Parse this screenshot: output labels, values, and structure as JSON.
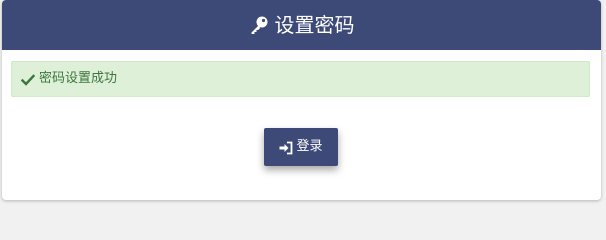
{
  "header": {
    "icon": "key-icon",
    "title": "设置密码",
    "background": "#3d4977"
  },
  "alert": {
    "icon": "check-icon",
    "message": "密码设置成功",
    "background": "#dff0d8",
    "text_color": "#3c763d"
  },
  "login_button": {
    "icon": "sign-in-icon",
    "label": "登录",
    "background": "#3d4977"
  }
}
